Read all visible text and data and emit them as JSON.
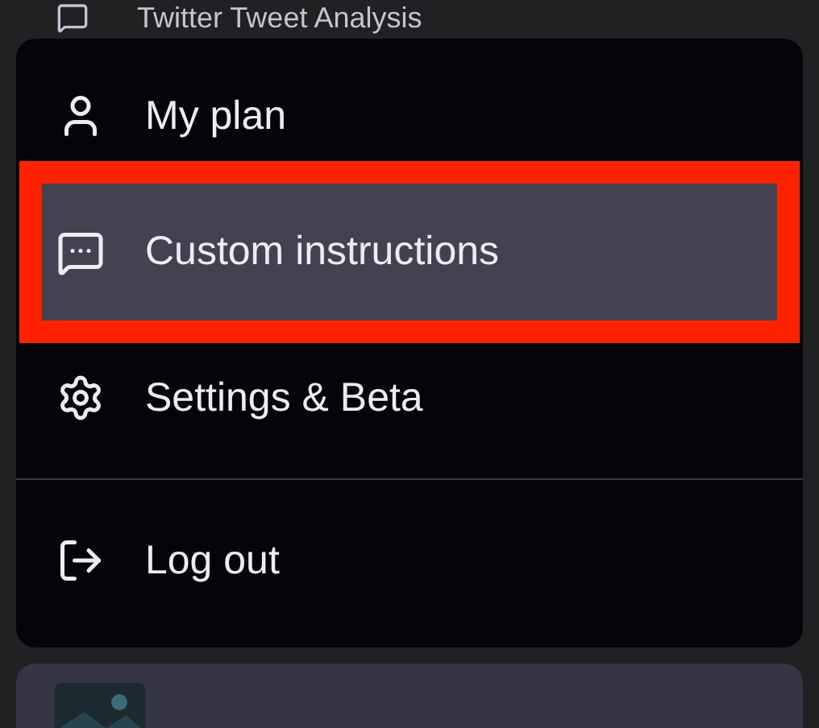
{
  "history_item": {
    "title": "Twitter Tweet Analysis"
  },
  "menu": {
    "items": [
      {
        "kind": "user",
        "label": "My plan",
        "selected": false
      },
      {
        "kind": "chat",
        "label": "Custom instructions",
        "selected": true
      },
      {
        "kind": "settings",
        "label": "Settings & Beta",
        "selected": false
      },
      {
        "kind": "divider"
      },
      {
        "kind": "logout",
        "label": "Log out",
        "selected": false
      }
    ]
  }
}
